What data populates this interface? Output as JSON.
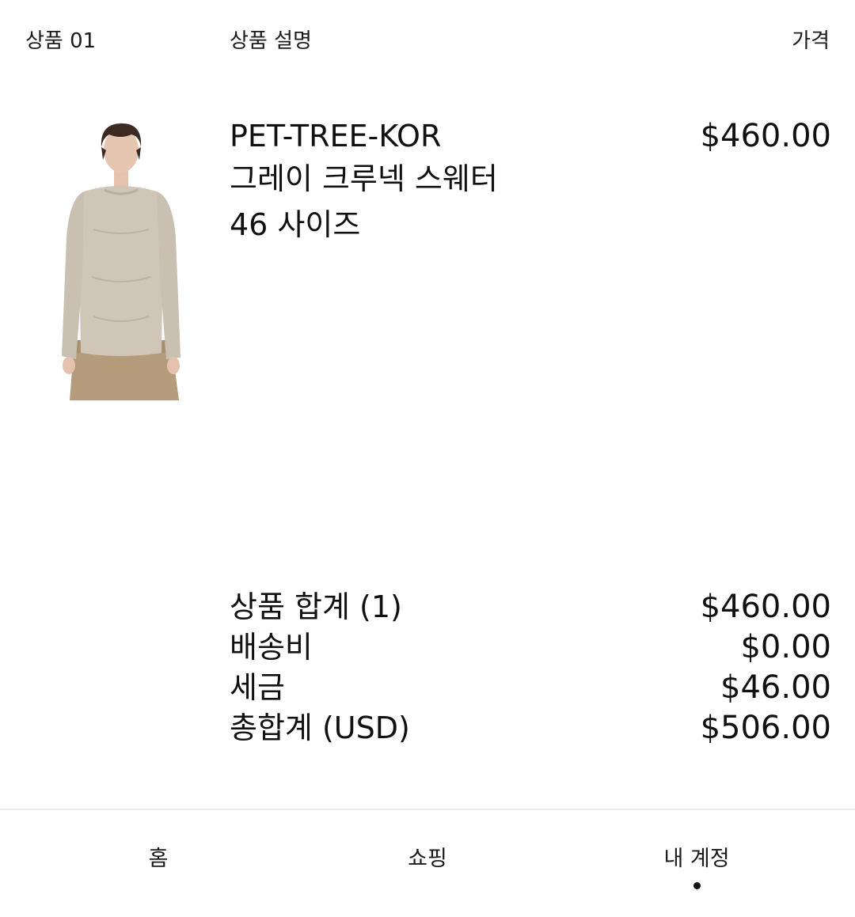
{
  "header": {
    "item_label": "상품 01",
    "description_label": "상품 설명",
    "price_label": "가격"
  },
  "product": {
    "brand": "PET-TREE-KOR",
    "name": "그레이 크루넥 스웨터",
    "size": "46 사이즈",
    "price": "$460.00"
  },
  "summary": {
    "rows": [
      {
        "label": "상품 합계 (1)",
        "value": "$460.00"
      },
      {
        "label": "배송비",
        "value": "$0.00"
      },
      {
        "label": "세금",
        "value": "$46.00"
      },
      {
        "label": "총합계 (USD)",
        "value": "$506.00"
      }
    ]
  },
  "nav": {
    "home": "홈",
    "shopping": "쇼핑",
    "account": "내 계정",
    "active": "account"
  },
  "colors": {
    "text": "#111111",
    "sweater": "#cfc6b8",
    "pants": "#b39b7b",
    "divider": "#ececec"
  }
}
